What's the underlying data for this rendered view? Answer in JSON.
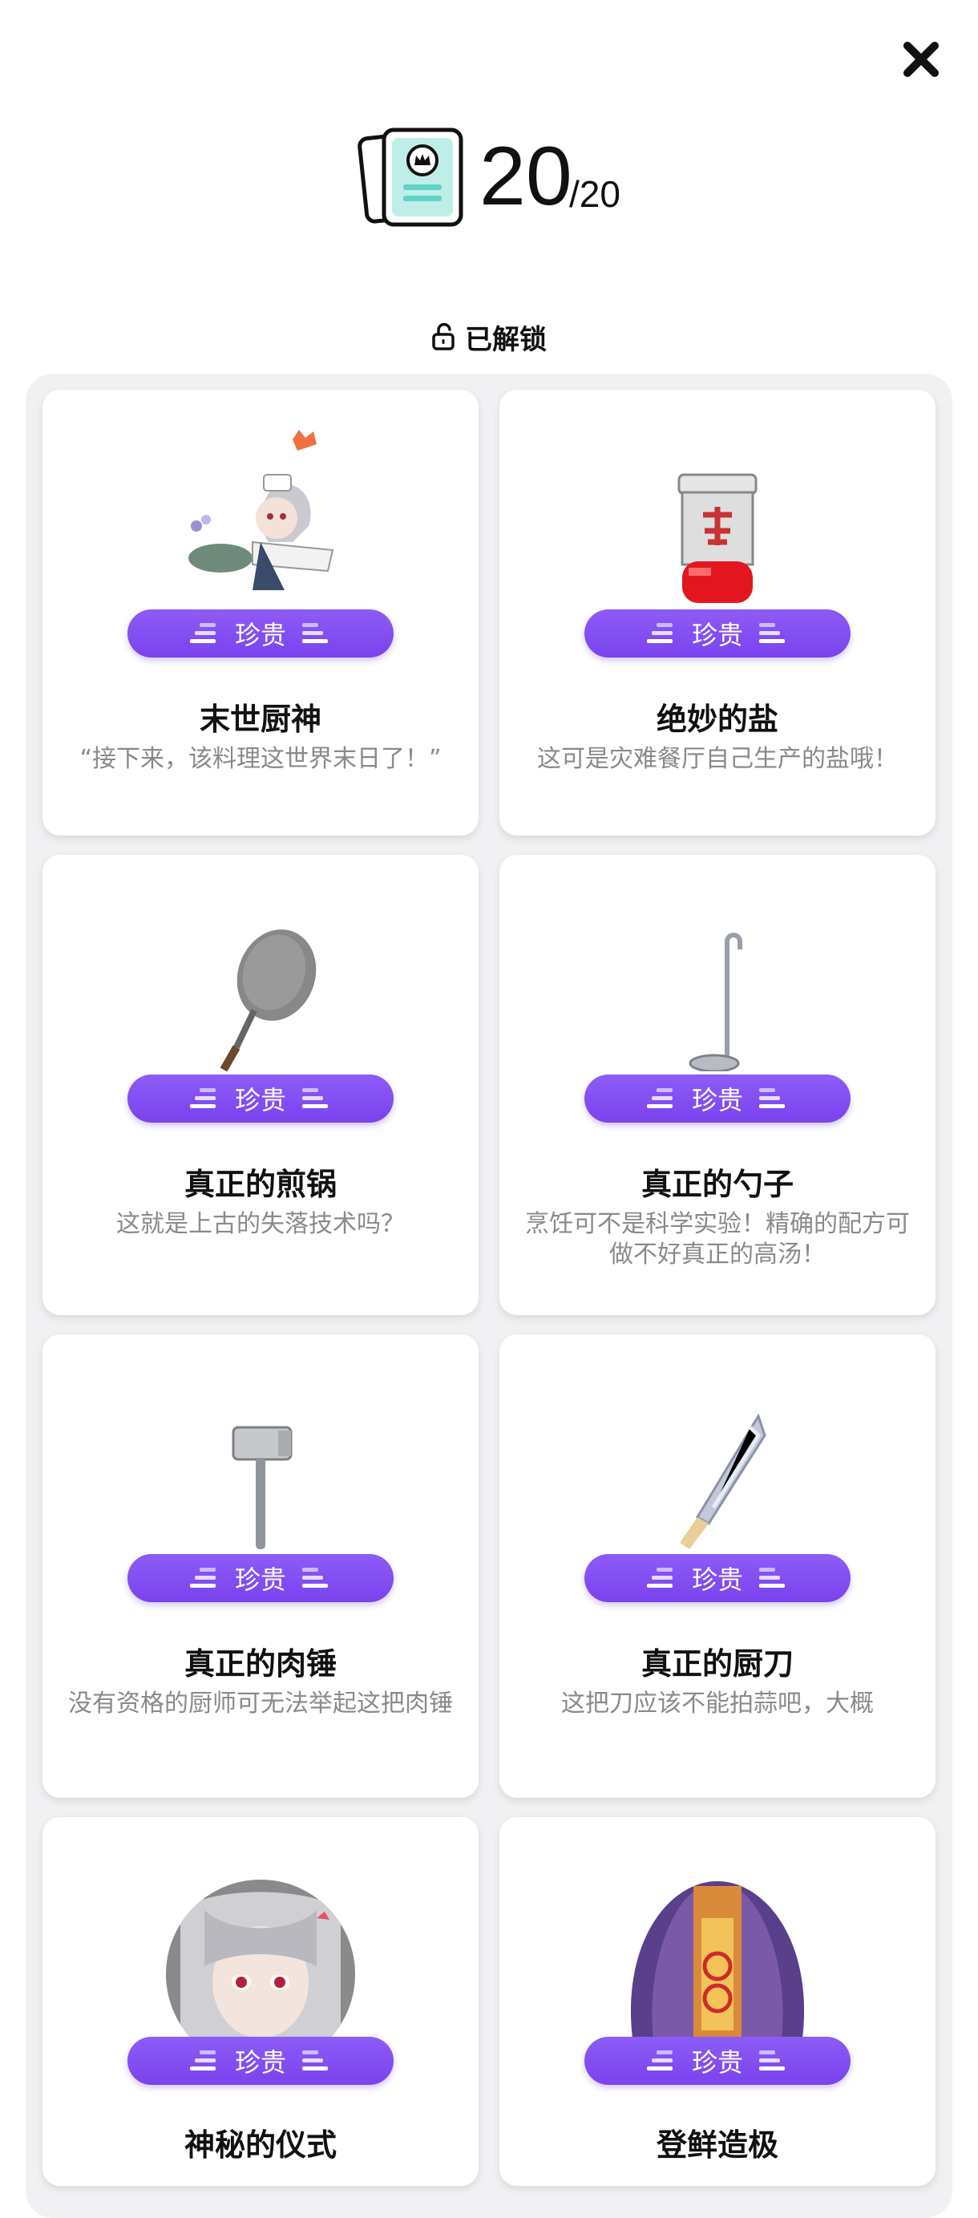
{
  "header": {
    "count": "20",
    "total": "/20",
    "unlocked_label": "已解锁"
  },
  "cards": [
    {
      "rarity": "珍贵",
      "title": "末世厨神",
      "desc": "“接下来，该料理这世界末日了！”",
      "art": "chef-girl"
    },
    {
      "rarity": "珍贵",
      "title": "绝妙的盐",
      "desc": "这可是灾难餐厅自己生产的盐哦！",
      "art": "salt-shaker"
    },
    {
      "rarity": "珍贵",
      "title": "真正的煎锅",
      "desc": "这就是上古的失落技术吗？",
      "art": "frying-pan"
    },
    {
      "rarity": "珍贵",
      "title": "真正的勺子",
      "desc": "烹饪可不是科学实验！精确的配方可做不好真正的高汤！",
      "art": "ladle"
    },
    {
      "rarity": "珍贵",
      "title": "真正的肉锤",
      "desc": "没有资格的厨师可无法举起这把肉锤",
      "art": "meat-mallet"
    },
    {
      "rarity": "珍贵",
      "title": "真正的厨刀",
      "desc": "这把刀应该不能拍蒜吧，大概",
      "art": "kitchen-knife"
    },
    {
      "rarity": "珍贵",
      "title": "神秘的仪式",
      "desc": "",
      "art": "ritual-portrait"
    },
    {
      "rarity": "珍贵",
      "title": "登鲜造极",
      "desc": "",
      "art": "shell-shrine"
    }
  ],
  "colors": {
    "accent": "#7b46ef",
    "panel": "#f1f1f3",
    "desc_text": "#8a8a8a"
  },
  "icons": {
    "close": "close-icon",
    "album": "album-icon",
    "unlock": "unlock-icon"
  }
}
